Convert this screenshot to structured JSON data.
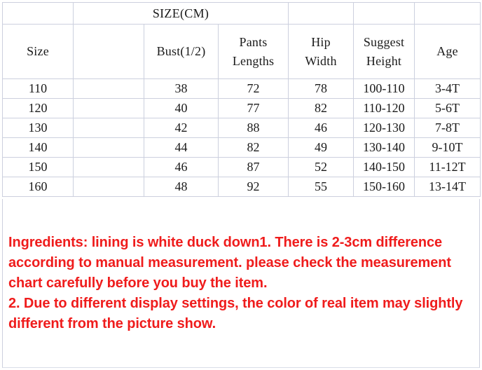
{
  "table": {
    "title": "SIZE(CM)",
    "columns": [
      {
        "key": "size",
        "label": "Size",
        "label_lines": [
          "Size"
        ]
      },
      {
        "key": "blank",
        "label": "",
        "label_lines": [
          ""
        ]
      },
      {
        "key": "bust",
        "label": "Bust(1/2)",
        "label_lines": [
          "Bust(1/2)"
        ]
      },
      {
        "key": "pants",
        "label": "Pants Lengths",
        "label_lines": [
          "Pants",
          "Lengths"
        ]
      },
      {
        "key": "hip",
        "label": "Hip Width",
        "label_lines": [
          "Hip",
          "Width"
        ]
      },
      {
        "key": "height",
        "label": "Suggest Height",
        "label_lines": [
          "Suggest",
          "Height"
        ]
      },
      {
        "key": "age",
        "label": "Age",
        "label_lines": [
          "Age"
        ]
      }
    ],
    "rows": [
      {
        "size": "110",
        "blank": "",
        "bust": "38",
        "pants": "72",
        "hip": "78",
        "height": "100-110",
        "age": "3-4T"
      },
      {
        "size": "120",
        "blank": "",
        "bust": "40",
        "pants": "77",
        "hip": "82",
        "height": "110-120",
        "age": "5-6T"
      },
      {
        "size": "130",
        "blank": "",
        "bust": "42",
        "pants": "88",
        "hip": "46",
        "height": "120-130",
        "age": "7-8T"
      },
      {
        "size": "140",
        "blank": "",
        "bust": "44",
        "pants": "82",
        "hip": "49",
        "height": "130-140",
        "age": "9-10T"
      },
      {
        "size": "150",
        "blank": "",
        "bust": "46",
        "pants": "87",
        "hip": "52",
        "height": "140-150",
        "age": "11-12T"
      },
      {
        "size": "160",
        "blank": "",
        "bust": "48",
        "pants": "92",
        "hip": "55",
        "height": "150-160",
        "age": "13-14T"
      }
    ]
  },
  "notice": {
    "paragraph_1": "Ingredients: lining is white duck down1. There is 2-3cm difference according to manual measurement. please check the measurement chart carefully before you buy the item.",
    "paragraph_2": "2. Due to different display settings, the color of real item may slightly different from the picture show."
  },
  "colors": {
    "title_red": "#e8201c",
    "notice_red": "#ef1c1c",
    "grid_line": "#ccd0de",
    "text": "#1a1a1a",
    "background": "#ffffff"
  }
}
